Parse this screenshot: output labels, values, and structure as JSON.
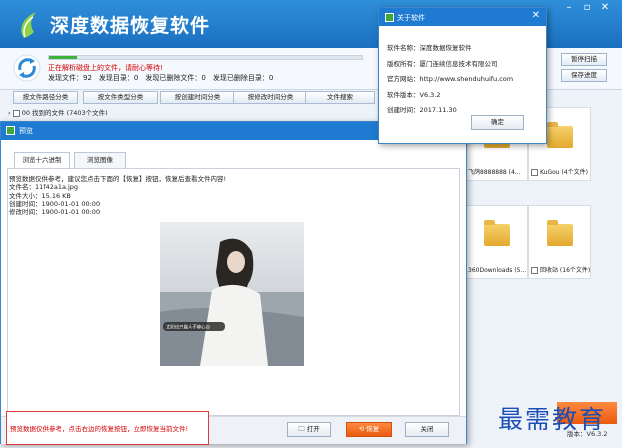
{
  "app": {
    "name": "深度数据恢复软件"
  },
  "window_controls": {
    "minimize": "–",
    "restore": "▫",
    "close": "✕"
  },
  "scan": {
    "progress": 0.09,
    "status": "正在解析磁盘上的文件，请耐心等待!",
    "counts": [
      "发现文件：92",
      "发现目录：0",
      "发现已删除文件：0",
      "发现已删除目录：0"
    ]
  },
  "side_buttons": {
    "stop": "暂停扫描",
    "save": "保存进度"
  },
  "category_tabs": [
    "按文件路径分类",
    "按文件类型分类",
    "按创建时间分类",
    "按修改时间分类",
    "文件搜索"
  ],
  "tree": {
    "first_row": "00 找到的文件 (7403个文件)"
  },
  "tiles": [
    {
      "label": "飞鸽8888888 (4..."
    },
    {
      "label": "KuGou (4个文件)"
    },
    {
      "label": "360Downloads (5..."
    },
    {
      "label": "回收站 (16个文件)"
    }
  ],
  "watermark": "最需教育",
  "version_footer": "版本：V6.3.2",
  "about": {
    "title": "关于软件",
    "lines": [
      "软件名称：深度数据恢复软件",
      "版权所有：厦门连续信息技术有限公司",
      "官方网站：http://www.shenduhuifu.com",
      "软件版本：V6.3.2",
      "创建时间：2017.11.30"
    ],
    "ok": "确定"
  },
  "preview": {
    "title": "预览",
    "tabs": [
      "浏览十六进制",
      "浏览图像"
    ],
    "info": [
      "预览数据仅供参考，建议您点击下面的【恢复】按钮，恢复后查看文件内容!",
      "文件名：11f42a1a.jpg",
      "文件大小：15.16 KB",
      "创建时间：1900-01-01  00:00",
      "修改时间：1900-01-01  00:00"
    ],
    "photo_caption": "太阳也只能人不够心😊",
    "footer_msg": "预览数据仅供参考，点击右边的恢复按钮，立即恢复当前文件!",
    "open": "打开",
    "recover": "恢复",
    "close": "关闭"
  }
}
